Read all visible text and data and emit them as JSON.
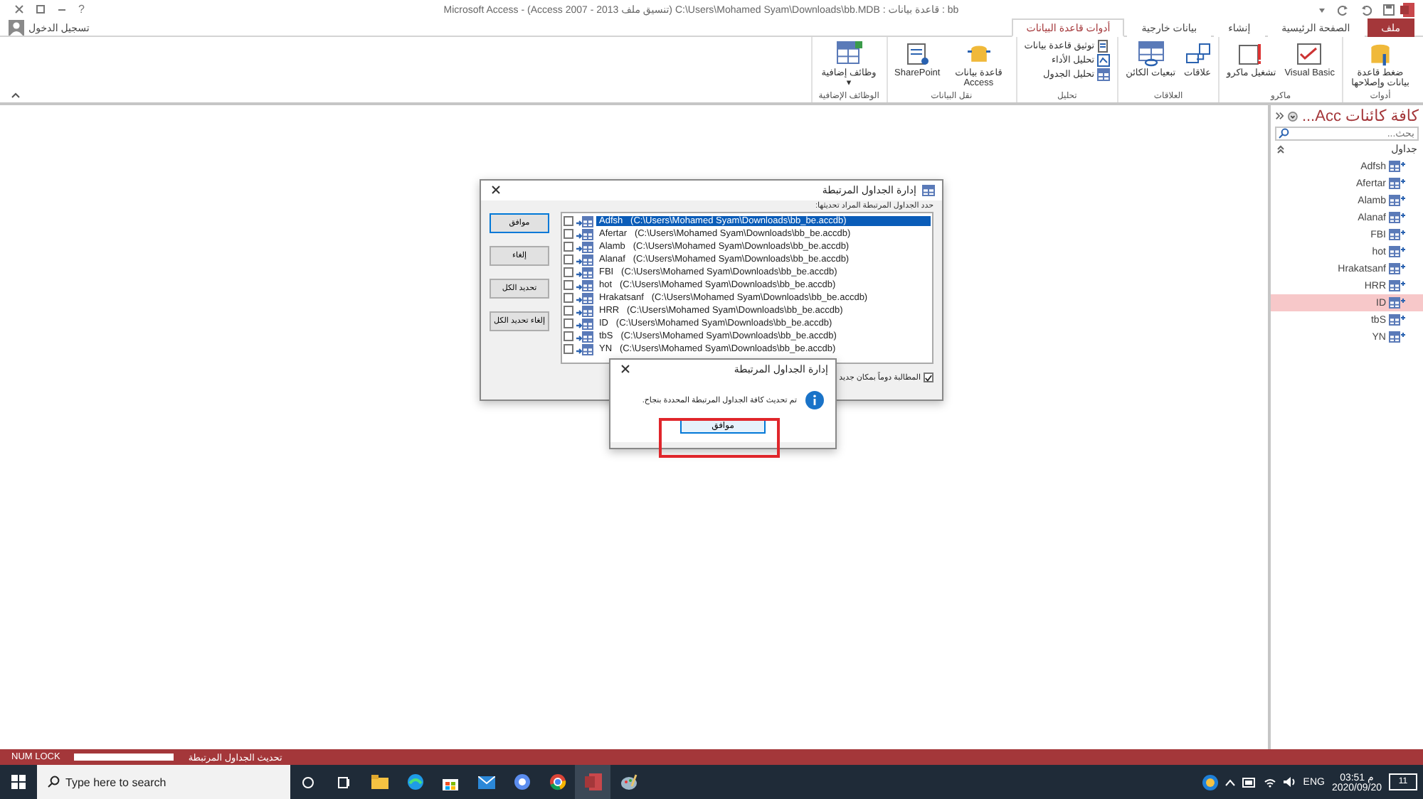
{
  "window": {
    "title": "Microsoft Access - (Access 2007 - 2013 تنسيق ملف) C:\\Users\\Mohamed Syam\\Downloads\\bb.MDB : قاعدة بيانات : bb",
    "help": "?",
    "sign_in": "تسجيل الدخول"
  },
  "tabs": [
    {
      "label": "ملف",
      "kind": "file",
      "selected": false
    },
    {
      "label": "الصفحة الرئيسية",
      "kind": "tab",
      "selected": false
    },
    {
      "label": "إنشاء",
      "kind": "tab",
      "selected": false
    },
    {
      "label": "بيانات خارجية",
      "kind": "tab",
      "selected": false
    },
    {
      "label": "أدوات قاعدة البيانات",
      "kind": "tab",
      "selected": true
    }
  ],
  "ribbon_groups": [
    {
      "label": "أدوات",
      "commands": [
        {
          "label": "ضغط قاعدة بيانات وإصلاحها",
          "kind": "large"
        }
      ]
    },
    {
      "label": "ماكرو",
      "commands": [
        {
          "label": "Visual Basic",
          "kind": "large"
        },
        {
          "label": "تشغيل ماكرو",
          "kind": "large"
        }
      ]
    },
    {
      "label": "العلاقات",
      "commands": [
        {
          "label": "علاقات",
          "kind": "large"
        },
        {
          "label": "تبعيات الكائن",
          "kind": "large"
        }
      ]
    },
    {
      "label": "تحليل",
      "commands": [
        {
          "label": "توثيق قاعدة بيانات",
          "kind": "small"
        },
        {
          "label": "تحليل الأداء",
          "kind": "small"
        },
        {
          "label": "تحليل الجدول",
          "kind": "small"
        }
      ]
    },
    {
      "label": "نقل البيانات",
      "commands": [
        {
          "label": "قاعدة بيانات Access",
          "kind": "large"
        },
        {
          "label": "SharePoint",
          "kind": "large"
        }
      ]
    },
    {
      "label": "الوظائف الإضافية",
      "commands": [
        {
          "label": "وظائف إضافية ▾",
          "kind": "large"
        }
      ]
    }
  ],
  "nav_pane": {
    "title": "كافة كائنات Acc...",
    "search": {
      "placeholder": "بحث..."
    },
    "section": "جداول",
    "items": [
      {
        "label": "Adfsh",
        "selected": false
      },
      {
        "label": "Afertar",
        "selected": false
      },
      {
        "label": "Alamb",
        "selected": false
      },
      {
        "label": "Alanaf",
        "selected": false
      },
      {
        "label": "FBI",
        "selected": false
      },
      {
        "label": "hot",
        "selected": false
      },
      {
        "label": "Hrakatsanf",
        "selected": false
      },
      {
        "label": "HRR",
        "selected": false
      },
      {
        "label": "ID",
        "selected": true
      },
      {
        "label": "tbS",
        "selected": false
      },
      {
        "label": "YN",
        "selected": false
      }
    ]
  },
  "linked_table_dialog": {
    "title": "إدارة الجداول المرتبطة",
    "instruction": "حدد الجداول المرتبطة المراد تحديثها:",
    "buttons": [
      "موافق",
      "إلغاء",
      "تحديد الكل",
      "إلغاء تحديد الكل"
    ],
    "tables": [
      {
        "name": "Adfsh",
        "path": "(C:\\Users\\Mohamed Syam\\Downloads\\bb_be.accdb)",
        "checked": false,
        "selected": true
      },
      {
        "name": "Afertar",
        "path": "(C:\\Users\\Mohamed Syam\\Downloads\\bb_be.accdb)",
        "checked": false,
        "selected": false
      },
      {
        "name": "Alamb",
        "path": "(C:\\Users\\Mohamed Syam\\Downloads\\bb_be.accdb)",
        "checked": false,
        "selected": false
      },
      {
        "name": "Alanaf",
        "path": "(C:\\Users\\Mohamed Syam\\Downloads\\bb_be.accdb)",
        "checked": false,
        "selected": false
      },
      {
        "name": "FBI",
        "path": "(C:\\Users\\Mohamed Syam\\Downloads\\bb_be.accdb)",
        "checked": false,
        "selected": false
      },
      {
        "name": "hot",
        "path": "(C:\\Users\\Mohamed Syam\\Downloads\\bb_be.accdb)",
        "checked": false,
        "selected": false
      },
      {
        "name": "Hrakatsanf",
        "path": "(C:\\Users\\Mohamed Syam\\Downloads\\bb_be.accdb)",
        "checked": false,
        "selected": false
      },
      {
        "name": "HRR",
        "path": "(C:\\Users\\Mohamed Syam\\Downloads\\bb_be.accdb)",
        "checked": false,
        "selected": false
      },
      {
        "name": "ID",
        "path": "(C:\\Users\\Mohamed Syam\\Downloads\\bb_be.accdb)",
        "checked": false,
        "selected": false
      },
      {
        "name": "tbS",
        "path": "(C:\\Users\\Mohamed Syam\\Downloads\\bb_be.accdb)",
        "checked": false,
        "selected": false
      },
      {
        "name": "YN",
        "path": "(C:\\Users\\Mohamed Syam\\Downloads\\bb_be.accdb)",
        "checked": false,
        "selected": false
      }
    ],
    "always_prompt": {
      "label": "المطالبة دوماً بمكان جديد",
      "checked": true
    }
  },
  "message_box": {
    "title": "إدارة الجداول المرتبطة",
    "message": "تم تحديث كافة الجداول المرتبطة المحددة بنجاح.",
    "button": "موافق",
    "highlighted": true
  },
  "status_bar": {
    "num_lock": "NUM LOCK",
    "progress": {
      "level": 1
    },
    "text": "تحديث الجداول المرتبطة"
  },
  "taskbar": {
    "search": {
      "placeholder": "Type here to search"
    },
    "language": "ENG",
    "time": "03:51 م",
    "date": "2020/09/20",
    "notifications": "11"
  }
}
